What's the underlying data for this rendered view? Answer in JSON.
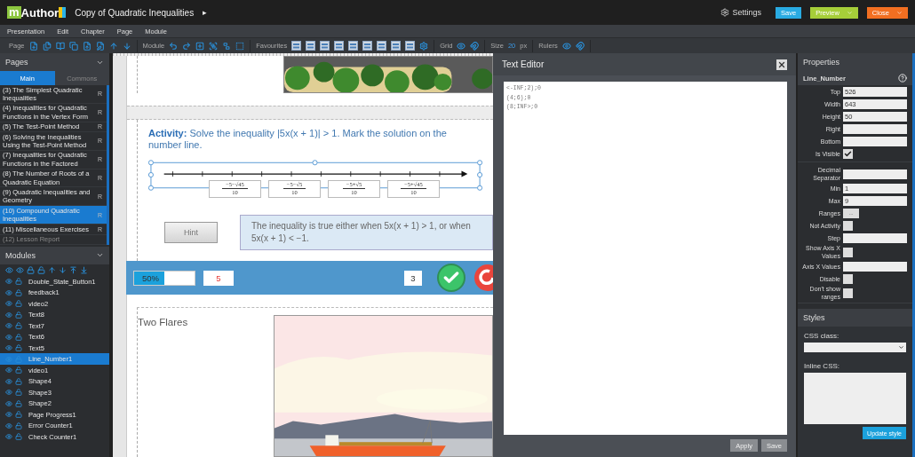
{
  "header": {
    "logo_mark": "m",
    "logo_text": "Author",
    "title": "Copy of Quadratic Inequalities",
    "title_arrow": "▸",
    "settings": "Settings",
    "save": "Save",
    "preview": "Preview",
    "close": "Close"
  },
  "menu": [
    "Presentation",
    "Edit",
    "Chapter",
    "Page",
    "Module"
  ],
  "toolbar": {
    "page": "Page",
    "module": "Module",
    "favourites": "Favourites",
    "grid": "Grid",
    "size_label": "Size",
    "size_value": "20",
    "size_unit": "px",
    "rulers": "Rulers"
  },
  "pages_panel": {
    "title": "Pages",
    "tabs": [
      {
        "label": "Main",
        "selected": true
      },
      {
        "label": "Commons",
        "selected": false
      }
    ],
    "items": [
      {
        "label": "(3) The Simplest Quadratic Inequalities",
        "mark": "R",
        "selected": false,
        "disabled": false
      },
      {
        "label": "(4) Inequalities for Quadratic Functions in the Vertex Form",
        "mark": "R",
        "selected": false,
        "disabled": false
      },
      {
        "label": "(5) The Test-Point Method",
        "mark": "R",
        "selected": false,
        "disabled": false
      },
      {
        "label": "(6) Solving the Inequalities Using the Test-Point Method",
        "mark": "R",
        "selected": false,
        "disabled": false
      },
      {
        "label": "(7) Inequalities for Quadratic Functions in the Factored",
        "mark": "R",
        "selected": false,
        "disabled": false
      },
      {
        "label": "(8) The Number of Roots of a Quadratic Equation",
        "mark": "R",
        "selected": false,
        "disabled": false
      },
      {
        "label": "(9) Quadratic Inequalities and Geometry",
        "mark": "R",
        "selected": false,
        "disabled": false
      },
      {
        "label": "(10) Compound Quadratic Inequalities",
        "mark": "R",
        "selected": true,
        "disabled": false
      },
      {
        "label": "(11) Miscellaneous Exercises",
        "mark": "R",
        "selected": false,
        "disabled": false
      },
      {
        "label": "(12) Lesson Report",
        "selected": false,
        "disabled": true
      }
    ]
  },
  "modules_panel": {
    "title": "Modules",
    "items": [
      {
        "label": "Double_State_Button1",
        "selected": false
      },
      {
        "label": "feedback1",
        "selected": false
      },
      {
        "label": "video2",
        "selected": false
      },
      {
        "label": "Text8",
        "selected": false
      },
      {
        "label": "Text7",
        "selected": false
      },
      {
        "label": "Text6",
        "selected": false
      },
      {
        "label": "Text5",
        "selected": false
      },
      {
        "label": "Line_Number1",
        "selected": true
      },
      {
        "label": "video1",
        "selected": false
      },
      {
        "label": "Shape4",
        "selected": false
      },
      {
        "label": "Shape3",
        "selected": false
      },
      {
        "label": "Shape2",
        "selected": false
      },
      {
        "label": "Page Progress1",
        "selected": false
      },
      {
        "label": "Error Counter1",
        "selected": false
      },
      {
        "label": "Check Counter1",
        "selected": false
      }
    ]
  },
  "canvas": {
    "activity": "**Activity:** Solve the inequality |5x(x + 1)| > 1. Mark the solution on the number line.",
    "number_line_labels": [
      {
        "numerator": "−5−√45",
        "denominator": "10"
      },
      {
        "numerator": "−5−√5",
        "denominator": "10"
      },
      {
        "numerator": "−5+√5",
        "denominator": "10"
      },
      {
        "numerator": "−5+√45",
        "denominator": "10"
      }
    ],
    "hint_button": "Hint",
    "hint_text": "The inequality is true either when 5x(x + 1) > 1, or when 5x(x + 1) < −1.",
    "progress": {
      "level": 0.5,
      "label": "50%"
    },
    "error_count": "5",
    "check_count": "3",
    "heading": "Two Flares"
  },
  "text_editor": {
    "title": "Text Editor",
    "lines": [
      "<-INF;2);0",
      "(4;6);0",
      "(8;INF>;0"
    ],
    "apply": "Apply",
    "save": "Save"
  },
  "properties": {
    "title": "Properties",
    "module_name": "Line_Number",
    "sections": [
      {
        "fields": [
          {
            "kind": "text",
            "label": "Top",
            "value": "526"
          },
          {
            "kind": "text",
            "label": "Width",
            "value": "643"
          },
          {
            "kind": "text",
            "label": "Height",
            "value": "50"
          },
          {
            "kind": "text",
            "label": "Right"
          },
          {
            "kind": "text",
            "label": "Bottom"
          },
          {
            "kind": "checkbox",
            "label": "Is Visible",
            "checked": true
          }
        ]
      },
      {
        "fields": [
          {
            "kind": "text",
            "label": "Decimal Separator"
          },
          {
            "kind": "text",
            "label": "Min",
            "value": "1"
          },
          {
            "kind": "text",
            "label": "Max",
            "value": "9"
          },
          {
            "kind": "button",
            "label": "Ranges",
            "value": "..."
          },
          {
            "kind": "checkbox",
            "label": "Not Activity",
            "checked": false
          },
          {
            "kind": "text",
            "label": "Step"
          },
          {
            "kind": "checkbox",
            "label": "Show Axis X Values",
            "checked": false
          },
          {
            "kind": "text",
            "label": "Axis X Values"
          },
          {
            "kind": "checkbox",
            "label": "Disable",
            "checked": false
          },
          {
            "kind": "checkbox",
            "label": "Don't show ranges",
            "checked": false
          }
        ]
      }
    ]
  },
  "styles": {
    "title": "Styles",
    "css_class_label": "CSS class:",
    "inline_css_label": "Inline CSS:",
    "update_button": "Update style"
  }
}
